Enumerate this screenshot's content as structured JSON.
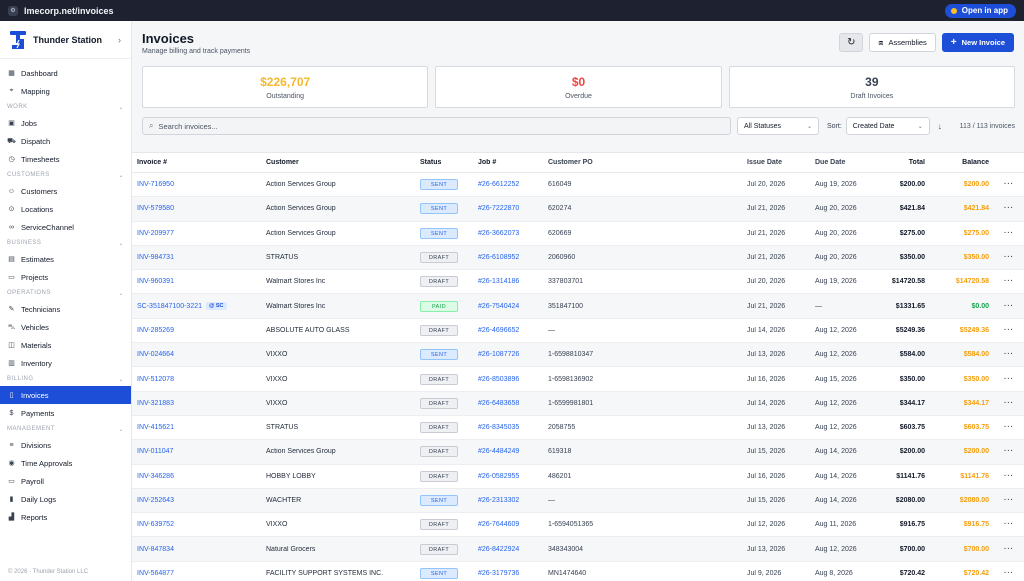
{
  "browser": {
    "url": "lmecorp.net/invoices",
    "open_app_label": "Open in app"
  },
  "sidebar": {
    "brand": "Thunder Station",
    "sections": [
      {
        "items": [
          {
            "label": "Dashboard",
            "icon": "grid-icon"
          },
          {
            "label": "Mapping",
            "icon": "map-pin-icon"
          }
        ]
      },
      {
        "title": "WORK",
        "items": [
          {
            "label": "Jobs",
            "icon": "briefcase-icon"
          },
          {
            "label": "Dispatch",
            "icon": "truck-icon"
          },
          {
            "label": "Timesheets",
            "icon": "clock-icon"
          }
        ]
      },
      {
        "title": "CUSTOMERS",
        "items": [
          {
            "label": "Customers",
            "icon": "users-icon"
          },
          {
            "label": "Locations",
            "icon": "location-icon"
          },
          {
            "label": "ServiceChannel",
            "icon": "link-icon"
          }
        ]
      },
      {
        "title": "BUSINESS",
        "items": [
          {
            "label": "Estimates",
            "icon": "calculator-icon"
          },
          {
            "label": "Projects",
            "icon": "folder-icon"
          }
        ]
      },
      {
        "title": "OPERATIONS",
        "items": [
          {
            "label": "Technicians",
            "icon": "wrench-icon"
          },
          {
            "label": "Vehicles",
            "icon": "car-icon"
          },
          {
            "label": "Materials",
            "icon": "box-icon"
          },
          {
            "label": "Inventory",
            "icon": "package-icon"
          }
        ]
      },
      {
        "title": "BILLING",
        "items": [
          {
            "label": "Invoices",
            "icon": "file-icon",
            "active": true
          },
          {
            "label": "Payments",
            "icon": "dollar-icon"
          }
        ]
      },
      {
        "title": "MANAGEMENT",
        "items": [
          {
            "label": "Divisions",
            "icon": "layers-icon"
          },
          {
            "label": "Time Approvals",
            "icon": "check-circle-icon"
          },
          {
            "label": "Payroll",
            "icon": "wallet-icon"
          },
          {
            "label": "Daily Logs",
            "icon": "book-icon"
          },
          {
            "label": "Reports",
            "icon": "chart-icon"
          }
        ]
      }
    ],
    "footer": "© 2026 · Thunder Station LLC"
  },
  "header": {
    "title": "Invoices",
    "subtitle": "Manage billing and track payments"
  },
  "actions": {
    "assemblies_label": "Assemblies",
    "new_invoice_label": "New Invoice"
  },
  "stats": [
    {
      "value": "$226,707",
      "label": "Outstanding",
      "color": "#f5b82e"
    },
    {
      "value": "$0",
      "label": "Overdue",
      "color": "#ef4444"
    },
    {
      "value": "39",
      "label": "Draft Invoices",
      "color": "#374151"
    }
  ],
  "filters": {
    "search_placeholder": "Search invoices...",
    "status_value": "All Statuses",
    "sort_label": "Sort:",
    "sort_value": "Created Date",
    "count": "113 / 113 invoices"
  },
  "table": {
    "columns": [
      "Invoice #",
      "Customer",
      "Status",
      "Job #",
      "Customer PO",
      "Issue Date",
      "Due Date",
      "Total",
      "Balance"
    ],
    "rows": [
      {
        "inv": "INV-716950",
        "cust": "Action Services Group",
        "status": "SENT",
        "job": "#26-6612252",
        "po": "616049",
        "issue": "Jul 20, 2026",
        "due": "Aug 19, 2026",
        "total": "$200.00",
        "bal": "$200.00",
        "bal_color": "orange"
      },
      {
        "inv": "INV-579580",
        "cust": "Action Services Group",
        "status": "SENT",
        "job": "#26-7222870",
        "po": "620274",
        "issue": "Jul 21, 2026",
        "due": "Aug 20, 2026",
        "total": "$421.84",
        "bal": "$421.84",
        "bal_color": "orange"
      },
      {
        "inv": "INV-209977",
        "cust": "Action Services Group",
        "status": "SENT",
        "job": "#26-3662073",
        "po": "620669",
        "issue": "Jul 21, 2026",
        "due": "Aug 20, 2026",
        "total": "$275.00",
        "bal": "$275.00",
        "bal_color": "orange"
      },
      {
        "inv": "INV-984731",
        "cust": "STRATUS",
        "status": "DRAFT",
        "job": "#26-6108952",
        "po": "2060960",
        "issue": "Jul 21, 2026",
        "due": "Aug 20, 2026",
        "total": "$350.00",
        "bal": "$350.00",
        "bal_color": "orange"
      },
      {
        "inv": "INV-960391",
        "cust": "Walmart Stores Inc",
        "status": "DRAFT",
        "job": "#26-1314186",
        "po": "337803701",
        "issue": "Jul 20, 2026",
        "due": "Aug 19, 2026",
        "total": "$14720.58",
        "bal": "$14720.58",
        "bal_color": "orange"
      },
      {
        "inv": "SC-351847100-3221",
        "sc": "@ SC",
        "cust": "Walmart Stores Inc",
        "status": "PAID",
        "job": "#26-7540424",
        "po": "351847100",
        "issue": "Jul 21, 2026",
        "due": "—",
        "total": "$1331.65",
        "bal": "$0.00",
        "bal_color": "green"
      },
      {
        "inv": "INV-285269",
        "cust": "ABSOLUTE AUTO GLASS",
        "status": "DRAFT",
        "job": "#26-4696652",
        "po": "—",
        "issue": "Jul 14, 2026",
        "due": "Aug 12, 2026",
        "total": "$5249.36",
        "bal": "$5249.36",
        "bal_color": "orange"
      },
      {
        "inv": "INV-024664",
        "cust": "VIXXO",
        "status": "SENT",
        "job": "#26-1087726",
        "po": "1-6598810347",
        "issue": "Jul 13, 2026",
        "due": "Aug 12, 2026",
        "total": "$584.00",
        "bal": "$584.00",
        "bal_color": "orange"
      },
      {
        "inv": "INV-512078",
        "cust": "VIXXO",
        "status": "DRAFT",
        "job": "#26-8503896",
        "po": "1-6598136902",
        "issue": "Jul 16, 2026",
        "due": "Aug 15, 2026",
        "total": "$350.00",
        "bal": "$350.00",
        "bal_color": "orange"
      },
      {
        "inv": "INV-321883",
        "cust": "VIXXO",
        "status": "DRAFT",
        "job": "#26-6483658",
        "po": "1-6599981801",
        "issue": "Jul 14, 2026",
        "due": "Aug 12, 2026",
        "total": "$344.17",
        "bal": "$344.17",
        "bal_color": "orange"
      },
      {
        "inv": "INV-415621",
        "cust": "STRATUS",
        "status": "DRAFT",
        "job": "#26-8345035",
        "po": "2058755",
        "issue": "Jul 13, 2026",
        "due": "Aug 12, 2026",
        "total": "$603.75",
        "bal": "$603.75",
        "bal_color": "orange"
      },
      {
        "inv": "INV-011047",
        "cust": "Action Services Group",
        "status": "DRAFT",
        "job": "#26-4484249",
        "po": "619318",
        "issue": "Jul 15, 2026",
        "due": "Aug 14, 2026",
        "total": "$200.00",
        "bal": "$200.00",
        "bal_color": "orange"
      },
      {
        "inv": "INV-346286",
        "cust": "HOBBY LOBBY",
        "status": "DRAFT",
        "job": "#26-0582955",
        "po": "486201",
        "issue": "Jul 16, 2026",
        "due": "Aug 14, 2026",
        "total": "$1141.76",
        "bal": "$1141.76",
        "bal_color": "orange"
      },
      {
        "inv": "INV-252643",
        "cust": "WACHTER",
        "status": "SENT",
        "job": "#26-2313302",
        "po": "—",
        "issue": "Jul 15, 2026",
        "due": "Aug 14, 2026",
        "total": "$2080.00",
        "bal": "$2080.00",
        "bal_color": "orange"
      },
      {
        "inv": "INV-639752",
        "cust": "VIXXO",
        "status": "DRAFT",
        "job": "#26-7644609",
        "po": "1-6594051365",
        "issue": "Jul 12, 2026",
        "due": "Aug 11, 2026",
        "total": "$916.75",
        "bal": "$916.75",
        "bal_color": "orange"
      },
      {
        "inv": "INV-847834",
        "cust": "Natural Grocers",
        "status": "DRAFT",
        "job": "#26-8422924",
        "po": "348343004",
        "issue": "Jul 13, 2026",
        "due": "Aug 12, 2026",
        "total": "$700.00",
        "bal": "$700.00",
        "bal_color": "orange"
      },
      {
        "inv": "INV-564877",
        "cust": "FACILITY SUPPORT SYSTEMS INC.",
        "status": "SENT",
        "job": "#26-3179736",
        "po": "MN1474640",
        "issue": "Jul 9, 2026",
        "due": "Aug 8, 2026",
        "total": "$720.42",
        "bal": "$720.42",
        "bal_color": "orange"
      }
    ]
  }
}
